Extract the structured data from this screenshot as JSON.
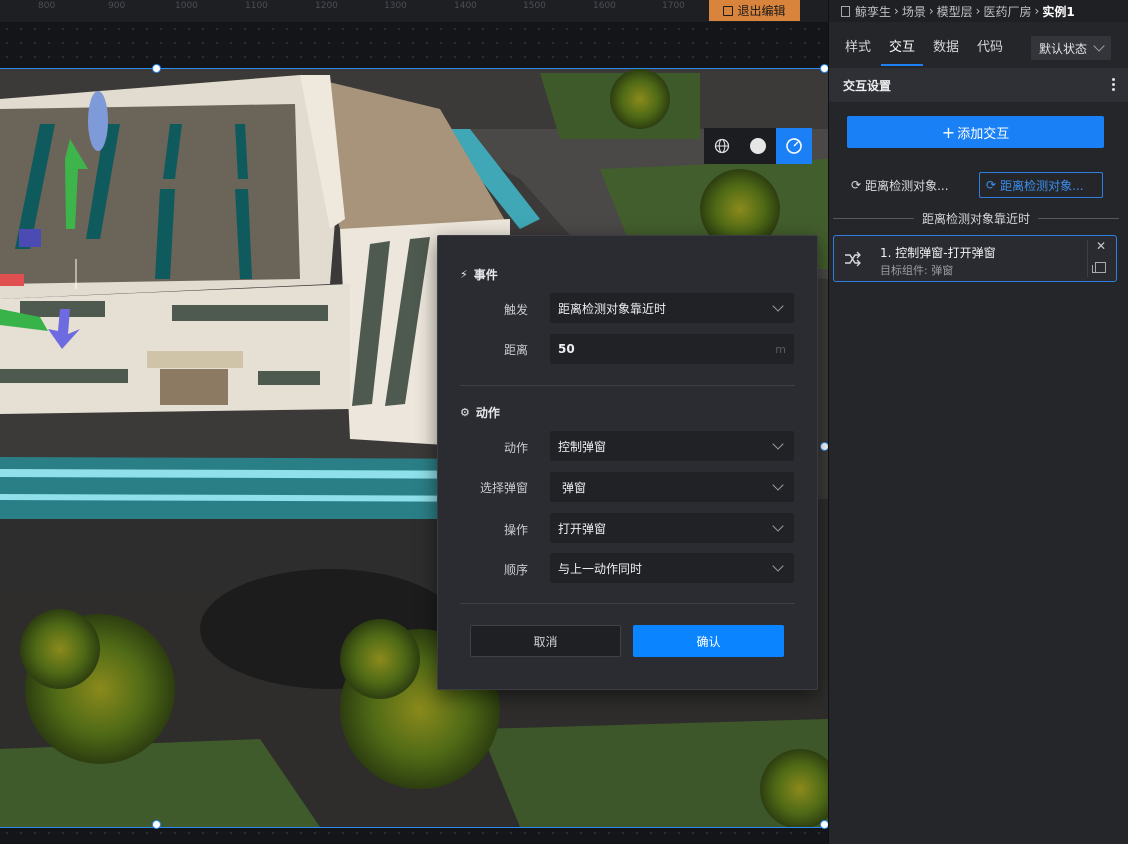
{
  "ruler": {
    "ticks": [
      "800",
      "900",
      "1000",
      "1100",
      "1200",
      "1300",
      "1400",
      "1500",
      "1600",
      "1700"
    ]
  },
  "toolbar": {
    "exit_label": "退出编辑"
  },
  "view_modes": [
    {
      "icon": "globe-icon",
      "active": false
    },
    {
      "icon": "sphere-icon",
      "active": false
    },
    {
      "icon": "orbit-icon",
      "active": true
    }
  ],
  "dialog": {
    "event_section": "事件",
    "trigger_label": "触发",
    "trigger_value": "距离检测对象靠近时",
    "distance_label": "距离",
    "distance_value": "50",
    "distance_unit": "m",
    "action_section": "动作",
    "action_label": "动作",
    "action_value": "控制弹窗",
    "popup_label": "选择弹窗",
    "popup_value": "弹窗",
    "operation_label": "操作",
    "operation_value": "打开弹窗",
    "order_label": "顺序",
    "order_value": "与上一动作同时",
    "cancel_label": "取消",
    "confirm_label": "确认"
  },
  "panel": {
    "breadcrumb": [
      "鲸孪生",
      "场景",
      "模型层",
      "医药厂房",
      "实例1"
    ],
    "tabs": [
      "样式",
      "交互",
      "数据",
      "代码"
    ],
    "active_tab": "交互",
    "state_select": "默认状态",
    "section_title": "交互设置",
    "add_button": "添加交互",
    "triggers": [
      "距离检测对象...",
      "距离检测对象..."
    ],
    "group_title": "距离检测对象靠近时",
    "card": {
      "title": "1. 控制弹窗-打开弹窗",
      "subtitle": "目标组件: 弹窗"
    }
  },
  "colors": {
    "accent": "#1a80f5",
    "exit": "#d9843c"
  }
}
